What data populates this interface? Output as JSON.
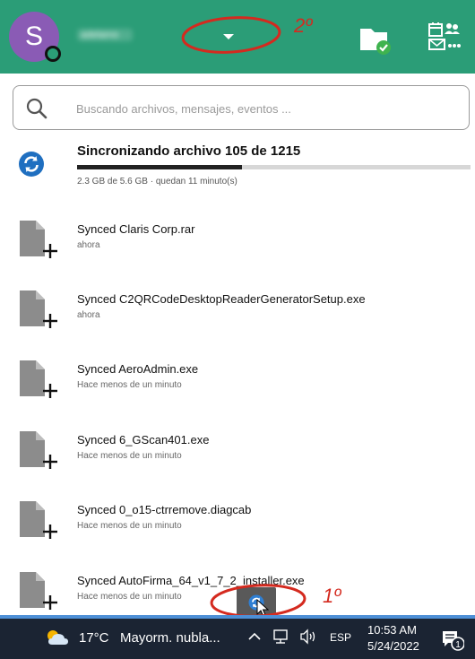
{
  "header": {
    "avatar_initial": "S",
    "user_name": "adelamo",
    "background_color": "#2b9d77",
    "avatar_color": "#8a5bb5",
    "dropdown_icon": "chevron-down-icon",
    "folder_icon": "synced-folder-icon",
    "apps_icon": "calendar-contacts-mail-icon"
  },
  "search": {
    "placeholder": "Buscando archivos, mensajes, eventos ..."
  },
  "sync": {
    "title": "Sincronizando archivo 105 de 1215",
    "detail": "2.3 GB de 5.6 GB · quedan 11 minuto(s)",
    "progress_fraction": 0.42
  },
  "files": [
    {
      "name": "Synced Claris Corp.rar",
      "time": "ahora"
    },
    {
      "name": "Synced C2QRCodeDesktopReaderGeneratorSetup.exe",
      "time": "ahora"
    },
    {
      "name": "Synced AeroAdmin.exe",
      "time": "Hace menos de un minuto"
    },
    {
      "name": "Synced 6_GScan401.exe",
      "time": "Hace menos de un minuto"
    },
    {
      "name": "Synced 0_o15-ctrremove.diagcab",
      "time": "Hace menos de un minuto"
    },
    {
      "name": "Synced AutoFirma_64_v1_7_2_installer.exe",
      "time": "Hace menos de un minuto"
    }
  ],
  "annotations": {
    "first": "1º",
    "second": "2º",
    "color": "#d42a1f"
  },
  "taskbar": {
    "temperature": "17°C",
    "weather": "Mayorm. nubla...",
    "language": "ESP",
    "time": "10:53 AM",
    "date": "5/24/2022",
    "notification_count": "1",
    "accent_color": "#4d8fd6"
  }
}
